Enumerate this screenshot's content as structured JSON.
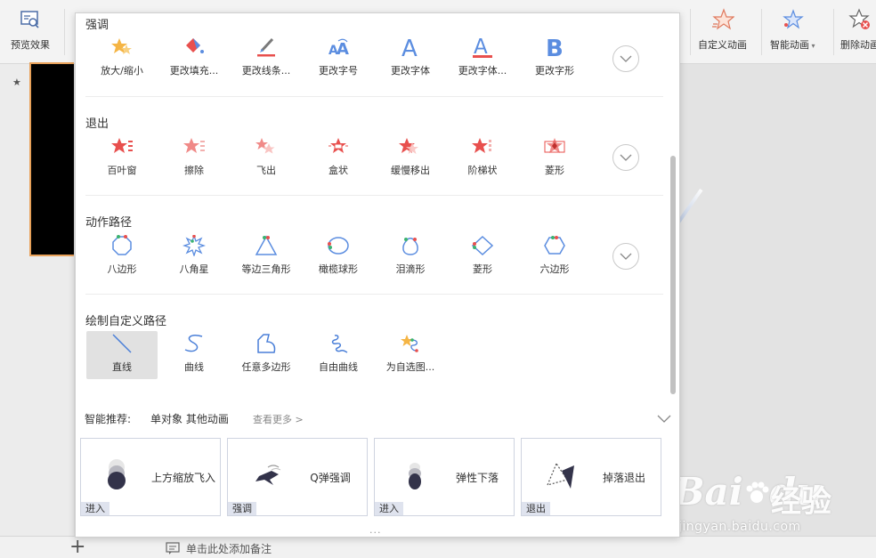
{
  "toolbar": {
    "preview": "预览效果",
    "custom_anim": "自定义动画",
    "smart_anim": "智能动画",
    "delete_anim": "删除动画"
  },
  "panel": {
    "sections": [
      {
        "title": "强调",
        "items": [
          "放大/缩小",
          "更改填充...",
          "更改线条...",
          "更改字号",
          "更改字体",
          "更改字体...",
          "更改字形"
        ]
      },
      {
        "title": "退出",
        "items": [
          "百叶窗",
          "擦除",
          "飞出",
          "盒状",
          "缓慢移出",
          "阶梯状",
          "菱形"
        ]
      },
      {
        "title": "动作路径",
        "items": [
          "八边形",
          "八角星",
          "等边三角形",
          "橄榄球形",
          "泪滴形",
          "菱形",
          "六边形"
        ]
      },
      {
        "title": "绘制自定义路径",
        "items": [
          "直线",
          "曲线",
          "任意多边形",
          "自由曲线",
          "为自选图..."
        ]
      }
    ],
    "reco": {
      "title": "智能推荐:",
      "subtitle": "单对象 其他动画",
      "more": "查看更多 >",
      "cards": [
        {
          "name": "上方缩放飞入",
          "tag": "进入"
        },
        {
          "name": "Q弹强调",
          "tag": "强调"
        },
        {
          "name": "弹性下落",
          "tag": "进入"
        },
        {
          "name": "掉落退出",
          "tag": "退出"
        }
      ]
    },
    "dots": "..."
  },
  "notes": {
    "placeholder": "单击此处添加备注"
  },
  "watermark": {
    "brand": "Bai",
    "brand2": "du",
    "cn": "经验",
    "url": "jingyan.baidu.com"
  },
  "colors": {
    "accent_red": "#e8504e",
    "accent_blue": "#5b8de0",
    "path_blue": "#4a7fd8",
    "star_orange": "#f5b545",
    "thumb_border": "#e8a15a"
  }
}
